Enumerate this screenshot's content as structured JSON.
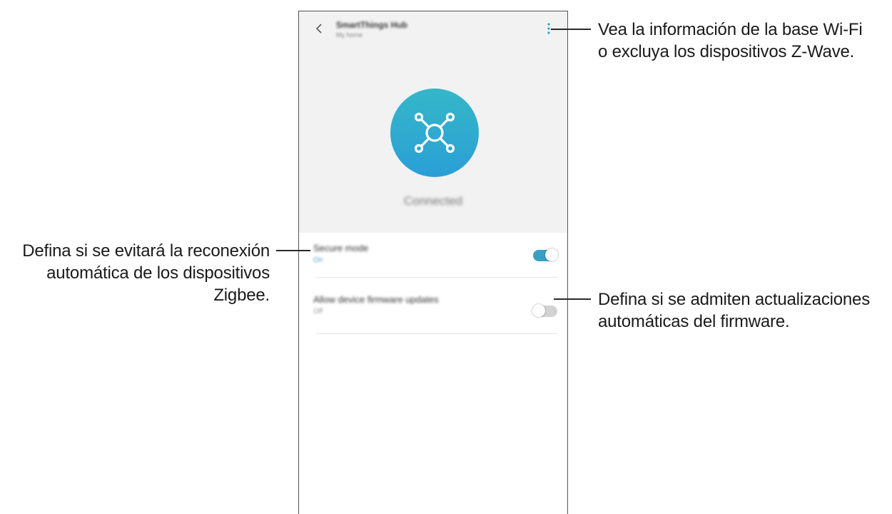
{
  "app_bar": {
    "title": "SmartThings Hub",
    "subtitle": "My home",
    "back_icon": "chevron-left-icon",
    "more_icon": "more-vertical-icon"
  },
  "hub": {
    "icon": "hub-network-icon",
    "status": "Connected",
    "colors": {
      "gradient_top": "#35b7c8",
      "gradient_bottom": "#2a9fd6"
    }
  },
  "settings": [
    {
      "title": "Secure mode",
      "subtitle": "On",
      "enabled": true
    },
    {
      "title": "Allow device firmware updates",
      "subtitle": "Off",
      "enabled": false
    }
  ],
  "colors": {
    "switch_on": "#3a9fc4",
    "switch_off": "#d2d2d2",
    "subtitle_on": "#3a9fc4"
  },
  "callouts": {
    "more_menu": [
      "Vea la información de la base Wi-Fi",
      "o excluya los dispositivos Z-Wave."
    ],
    "secure_mode": [
      "Defina si se evitará la reconexión",
      "automática de los dispositivos",
      "Zigbee."
    ],
    "firmware": [
      "Defina si se admiten actualizaciones",
      "automáticas del firmware."
    ]
  }
}
